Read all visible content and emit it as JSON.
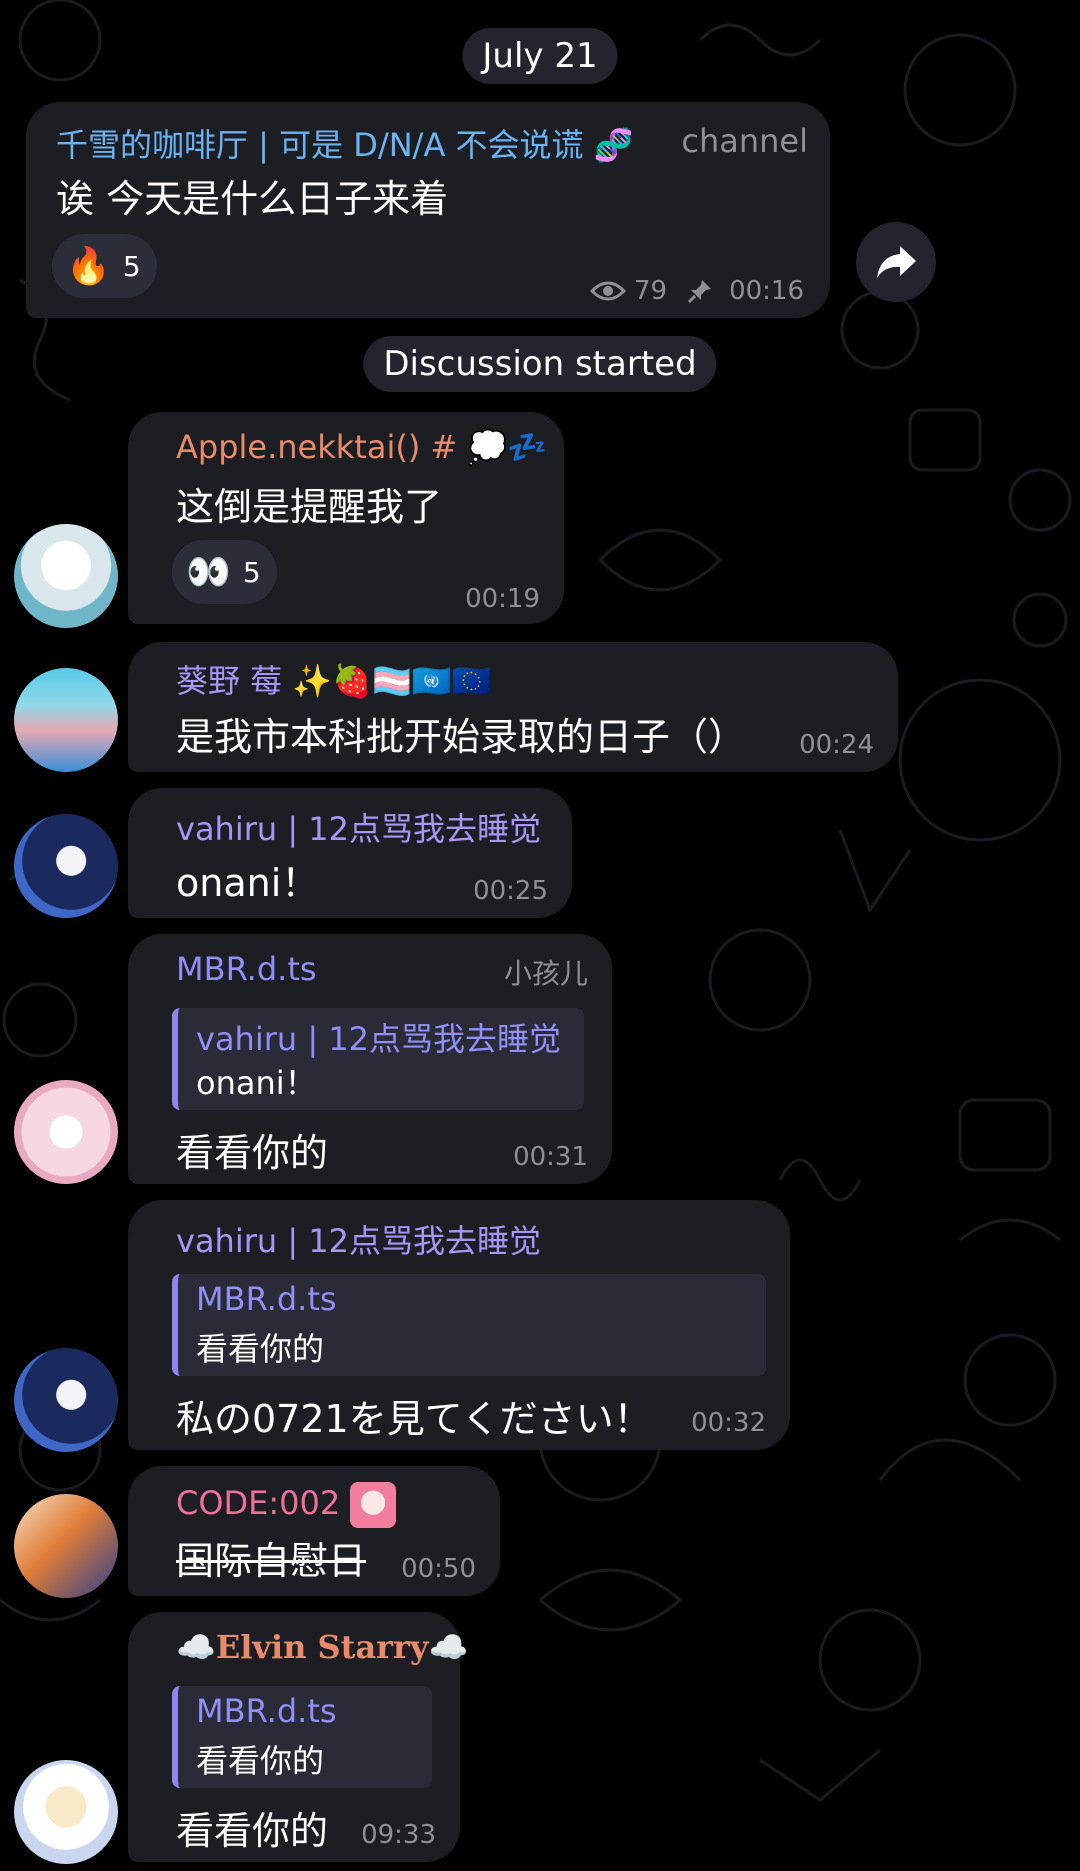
{
  "date_pill": "July 21",
  "discussion_pill": "Discussion started",
  "channel_post": {
    "sender": "千雪的咖啡厅 | 可是 D/N/A 不会说谎",
    "sender_emoji": "🧬",
    "badge": "channel",
    "text": "诶 今天是什么日子来着",
    "reaction_emoji": "🔥",
    "reaction_count": "5",
    "views": "79",
    "time": "00:16"
  },
  "messages": [
    {
      "sender": "Apple.nekktai() #",
      "sender_emoji": "💭💤",
      "text": "这倒是提醒我了",
      "reaction_emoji": "👀",
      "reaction_count": "5",
      "time": "00:19"
    },
    {
      "sender": "葵野 莓",
      "sender_emoji": "✨🍓🏳️‍⚧️🇺🇳🇪🇺",
      "text": "是我市本科批开始录取的日子（）",
      "time": "00:24"
    },
    {
      "sender": "vahiru | 12点骂我去睡觉",
      "text": "onani！",
      "time": "00:25"
    },
    {
      "sender": "MBR.d.ts",
      "side_label": "小孩儿",
      "quote_name": "vahiru | 12点骂我去睡觉",
      "quote_text": "onani！",
      "text": "看看你的",
      "time": "00:31"
    },
    {
      "sender": "vahiru | 12点骂我去睡觉",
      "quote_name": "MBR.d.ts",
      "quote_text": "看看你的",
      "text": "私の0721を見てください！",
      "time": "00:32"
    },
    {
      "sender": "CODE:002",
      "text": "国际自慰日",
      "time": "00:50"
    },
    {
      "sender": "☁️Elvin Starry☁️",
      "quote_name": "MBR.d.ts",
      "quote_text": "看看你的",
      "text": "看看你的",
      "time": "09:33"
    }
  ],
  "colors": {
    "background": "#000000",
    "bubble": "#1d1e24",
    "pill": "#24232e",
    "channel_name": "#6ab3f3",
    "name_orange": "#e98a6a",
    "name_violet": "#a696f5",
    "name_blue": "#8f8ff5",
    "name_pink": "#ee6f99",
    "time_gray": "#8f8f95"
  },
  "icons": {
    "views": "eye-icon",
    "pinned": "pin-icon",
    "forward": "forward-arrow-icon"
  }
}
